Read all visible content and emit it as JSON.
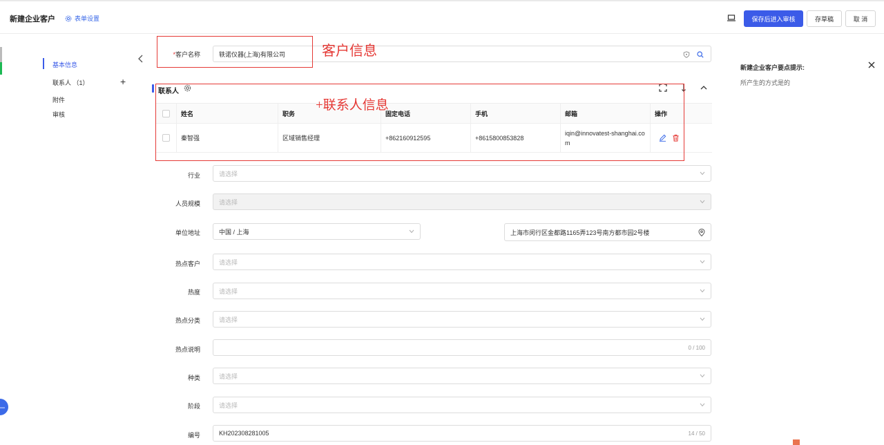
{
  "header": {
    "title": "新建企业客户",
    "form_settings": "表单设置",
    "save_review": "保存后进入审核",
    "save_draft": "存草稿",
    "cancel": "取 消"
  },
  "nav": {
    "items": [
      {
        "label": "基本信息"
      },
      {
        "label": "联系人 （1）"
      },
      {
        "label": "附件"
      },
      {
        "label": "审核"
      }
    ]
  },
  "form": {
    "customer_name": {
      "label": "客户名称",
      "required_mark": "*",
      "value": "轶诺仪器(上海)有限公司"
    },
    "industry": {
      "label": "行业",
      "placeholder": "请选择"
    },
    "staff_size": {
      "label": "人员规模",
      "placeholder": "请选择"
    },
    "address": {
      "label": "单位地址",
      "region": "中国 / 上海",
      "detail": "上海市闵行区金都路1165弄123号南方都市园2号楼"
    },
    "hot_customer": {
      "label": "热点客户",
      "placeholder": "请选择"
    },
    "heat": {
      "label": "热度",
      "placeholder": "请选择"
    },
    "hot_category": {
      "label": "热点分类",
      "placeholder": "请选择"
    },
    "hot_desc": {
      "label": "热点说明",
      "counter": "0 / 100"
    },
    "kind": {
      "label": "种类",
      "placeholder": "请选择"
    },
    "stage": {
      "label": "阶段",
      "placeholder": "请选择"
    },
    "code": {
      "label": "编号",
      "value": "KH202308281005",
      "counter": "14 / 50"
    }
  },
  "contacts": {
    "title": "联系人",
    "columns": [
      "姓名",
      "职务",
      "固定电话",
      "手机",
      "邮箱",
      "操作"
    ],
    "rows": [
      {
        "name": "秦智强",
        "position": "区域销售经理",
        "phone": "+862160912595",
        "mobile": "+8615800853828",
        "email_line1": "iqin@innovatest-shanghai.co",
        "email_line2": "m"
      }
    ]
  },
  "annotations": {
    "customer_info": "客户信息",
    "contact_info": "+联系人信息"
  },
  "tips": {
    "title": "新建企业客户要点提示:",
    "content": "所产生的方式是的"
  },
  "colors": {
    "primary": "#3b5be8",
    "annotation": "#e53935"
  }
}
